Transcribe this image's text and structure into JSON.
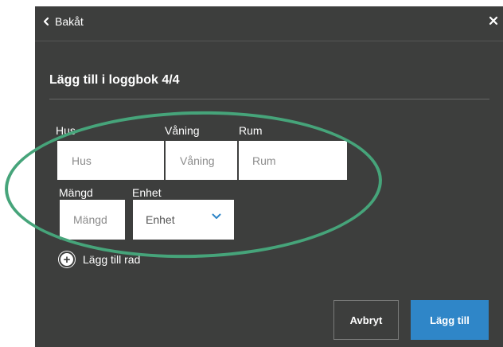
{
  "header": {
    "back_label": "Bakåt",
    "close_icon": "close-icon"
  },
  "title": "Lägg till i loggbok 4/4",
  "fields": {
    "hus": {
      "label": "Hus",
      "placeholder": "Hus"
    },
    "vaning": {
      "label": "Våning",
      "placeholder": "Våning"
    },
    "rum": {
      "label": "Rum",
      "placeholder": "Rum"
    },
    "mangd": {
      "label": "Mängd",
      "placeholder": "Mängd"
    },
    "enhet": {
      "label": "Enhet",
      "value": "Enhet"
    }
  },
  "add_row_label": "Lägg till rad",
  "buttons": {
    "cancel": "Avbryt",
    "submit": "Lägg till"
  },
  "colors": {
    "panel": "#3d3e3d",
    "primary": "#2f86c8",
    "highlight": "#46a47a"
  }
}
